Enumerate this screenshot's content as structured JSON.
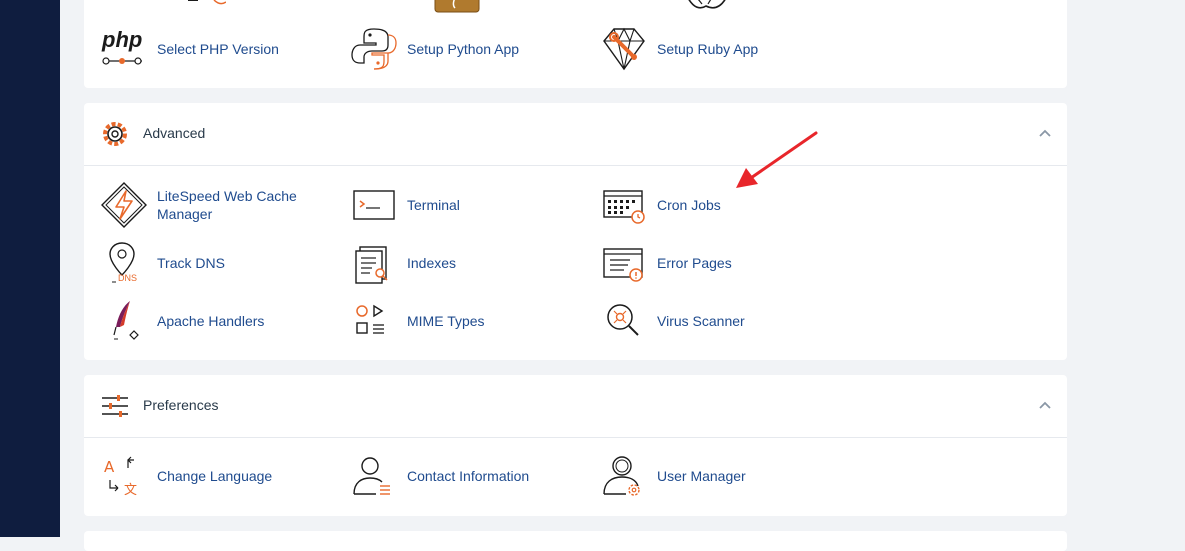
{
  "top_section": {
    "items": [
      {
        "label": "Select PHP Version",
        "icon": "php-icon"
      },
      {
        "label": "Setup Python App",
        "icon": "python-icon"
      },
      {
        "label": "Setup Ruby App",
        "icon": "ruby-icon"
      }
    ],
    "php_icon_text": "php"
  },
  "advanced": {
    "title": "Advanced",
    "items": [
      {
        "label": "LiteSpeed Web Cache Manager",
        "icon": "litespeed-icon"
      },
      {
        "label": "Terminal",
        "icon": "terminal-icon"
      },
      {
        "label": "Cron Jobs",
        "icon": "cron-jobs-icon"
      },
      {
        "label": "Track DNS",
        "icon": "track-dns-icon"
      },
      {
        "label": "Indexes",
        "icon": "indexes-icon"
      },
      {
        "label": "Error Pages",
        "icon": "error-pages-icon"
      },
      {
        "label": "Apache Handlers",
        "icon": "apache-handlers-icon"
      },
      {
        "label": "MIME Types",
        "icon": "mime-types-icon"
      },
      {
        "label": "Virus Scanner",
        "icon": "virus-scanner-icon"
      }
    ],
    "dns_icon_text": "DNS"
  },
  "preferences": {
    "title": "Preferences",
    "items": [
      {
        "label": "Change Language",
        "icon": "change-language-icon"
      },
      {
        "label": "Contact Information",
        "icon": "contact-information-icon"
      },
      {
        "label": "User Manager",
        "icon": "user-manager-icon"
      }
    ],
    "lang_icon_text_a": "A",
    "lang_icon_text_b": "文"
  },
  "colors": {
    "sidebar": "#0f1d3f",
    "link": "#1f4b8e",
    "accent_orange": "#e8692b",
    "annotation_arrow": "#e8262b"
  }
}
